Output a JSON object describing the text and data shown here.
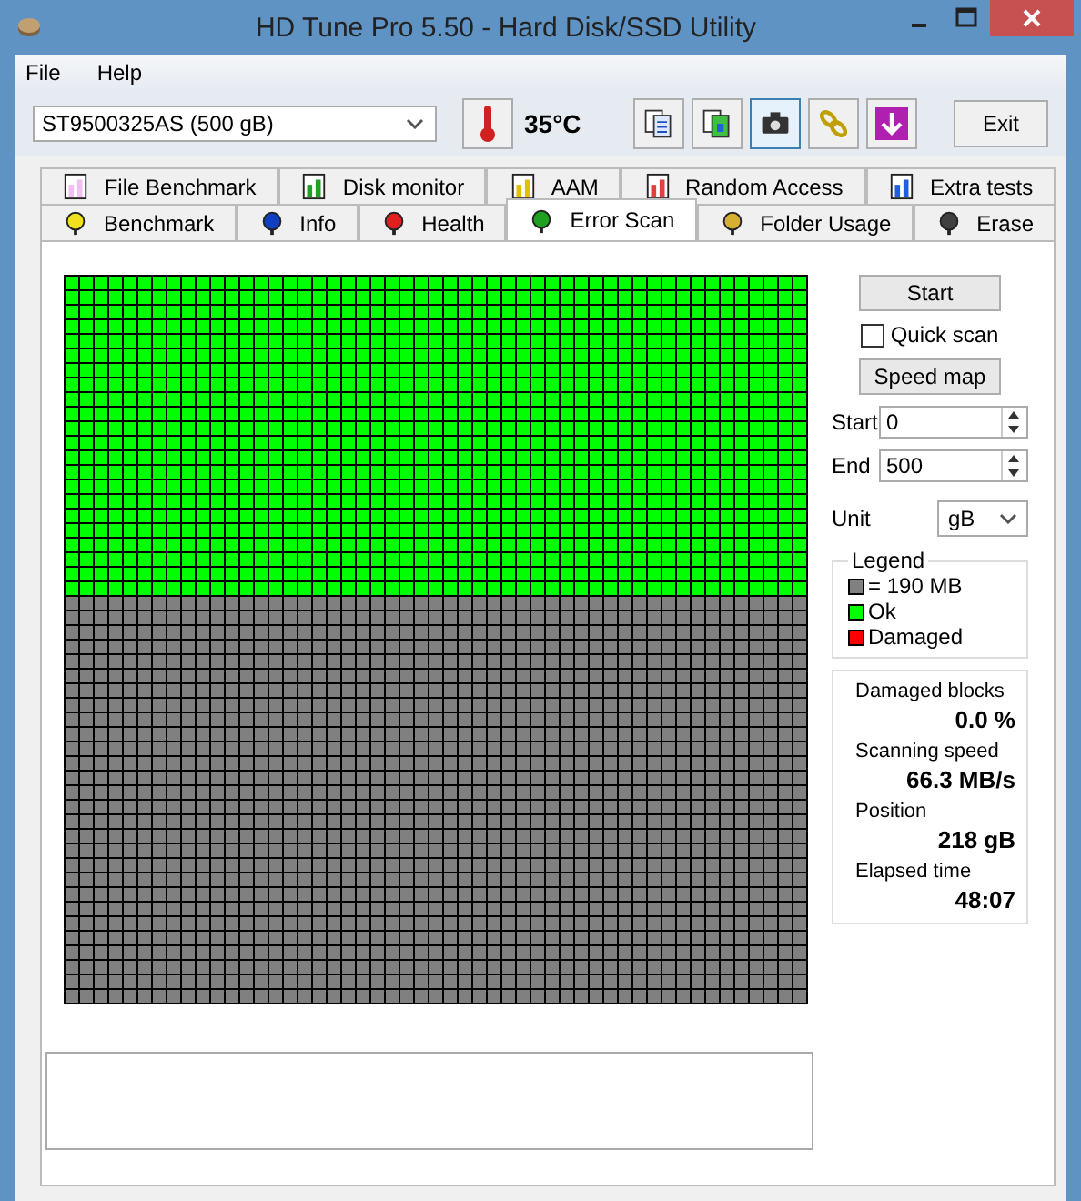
{
  "window": {
    "title": "HD Tune Pro 5.50 - Hard Disk/SSD Utility"
  },
  "menu": [
    "File",
    "Help"
  ],
  "toolbar": {
    "drive": "ST9500325AS (500 gB)",
    "temperature": "35°C",
    "exit": "Exit"
  },
  "tabs_top": [
    {
      "label": "File Benchmark",
      "selected": false
    },
    {
      "label": "Disk monitor",
      "selected": false
    },
    {
      "label": "AAM",
      "selected": false
    },
    {
      "label": "Random Access",
      "selected": false
    },
    {
      "label": "Extra tests",
      "selected": false
    }
  ],
  "tabs_bottom": [
    {
      "label": "Benchmark",
      "selected": false
    },
    {
      "label": "Info",
      "selected": false
    },
    {
      "label": "Health",
      "selected": false
    },
    {
      "label": "Error Scan",
      "selected": true
    },
    {
      "label": "Folder Usage",
      "selected": false
    },
    {
      "label": "Erase",
      "selected": false
    }
  ],
  "scan": {
    "level": 0.44
  },
  "controls": {
    "start_button": "Start",
    "quick_scan": {
      "label": "Quick scan",
      "checked": false
    },
    "speed_map": "Speed map",
    "start_label": "Start",
    "start_value": "0",
    "end_label": "End",
    "end_value": "500",
    "unit_label": "Unit",
    "unit_value": "gB"
  },
  "legend": {
    "title": "Legend",
    "items": [
      {
        "label": "= 190 MB",
        "color": "#808080"
      },
      {
        "label": "Ok",
        "color": "#00ff00"
      },
      {
        "label": "Damaged",
        "color": "#ff0000"
      }
    ]
  },
  "stats": [
    {
      "label": "Damaged blocks",
      "value": "0.0 %"
    },
    {
      "label": "Scanning speed",
      "value": "66.3 MB/s"
    },
    {
      "label": "Position",
      "value": "218 gB"
    },
    {
      "label": "Elapsed time",
      "value": "48:07"
    }
  ]
}
